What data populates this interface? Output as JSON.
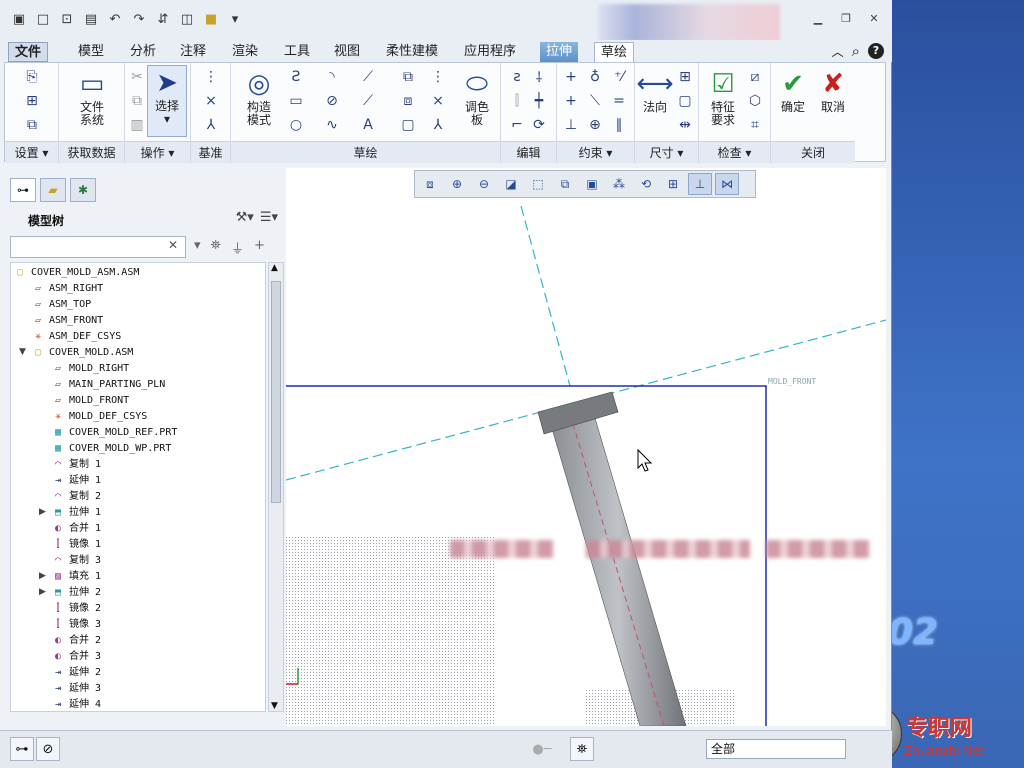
{
  "titlebar": {
    "qat_icons": [
      "app-icon",
      "new-icon",
      "open-icon",
      "save-icon",
      "undo-icon",
      "redo-icon",
      "regenerate-icon",
      "windows-icon",
      "folder-icon",
      "more-icon"
    ],
    "window_controls": [
      "minimize",
      "restore",
      "close"
    ]
  },
  "tabs": [
    "文件",
    "模型",
    "分析",
    "注释",
    "渲染",
    "工具",
    "视图",
    "柔性建模",
    "应用程序",
    "拉伸",
    "草绘"
  ],
  "ribbon": {
    "groups": [
      {
        "label": "设置",
        "dropdown": true
      },
      {
        "label": "获取数据"
      },
      {
        "label": "操作",
        "dropdown": true
      },
      {
        "label": "基准"
      },
      {
        "label": "草绘"
      },
      {
        "label": "编辑"
      },
      {
        "label": "约束",
        "dropdown": true
      },
      {
        "label": "尺寸",
        "dropdown": true
      },
      {
        "label": "检查",
        "dropdown": true
      },
      {
        "label": "关闭"
      }
    ],
    "file_system": "文件\n系统",
    "select": "选择",
    "construction_mode": "构造\n模式",
    "palette": "调色\n板",
    "normal": "法向",
    "feature_req": "特征\n要求",
    "ok": "确定",
    "cancel": "取消"
  },
  "model_tree": {
    "title": "模型树",
    "search_placeholder": "",
    "items": [
      {
        "label": "COVER_MOLD_ASM.ASM",
        "level": 0,
        "icon": "asm"
      },
      {
        "label": "ASM_RIGHT",
        "level": 1,
        "icon": "plane"
      },
      {
        "label": "ASM_TOP",
        "level": 1,
        "icon": "plane"
      },
      {
        "label": "ASM_FRONT",
        "level": 1,
        "icon": "plane"
      },
      {
        "label": "ASM_DEF_CSYS",
        "level": 1,
        "icon": "csys"
      },
      {
        "label": "COVER_MOLD.ASM",
        "level": 1,
        "icon": "asm",
        "expanded": true
      },
      {
        "label": "MOLD_RIGHT",
        "level": 2,
        "icon": "plane"
      },
      {
        "label": "MAIN_PARTING_PLN",
        "level": 2,
        "icon": "plane"
      },
      {
        "label": "MOLD_FRONT",
        "level": 2,
        "icon": "plane"
      },
      {
        "label": "MOLD_DEF_CSYS",
        "level": 2,
        "icon": "csys"
      },
      {
        "label": "COVER_MOLD_REF.PRT",
        "level": 2,
        "icon": "part"
      },
      {
        "label": "COVER_MOLD_WP.PRT",
        "level": 2,
        "icon": "part"
      },
      {
        "label": "复制 1",
        "level": 2,
        "icon": "surf"
      },
      {
        "label": "延伸 1",
        "level": 2,
        "icon": "extend"
      },
      {
        "label": "复制 2",
        "level": 2,
        "icon": "surf"
      },
      {
        "label": "拉伸 1",
        "level": 2,
        "icon": "extrude",
        "collapsed": true
      },
      {
        "label": "合并 1",
        "level": 2,
        "icon": "merge"
      },
      {
        "label": "镜像 1",
        "level": 2,
        "icon": "mirror"
      },
      {
        "label": "复制 3",
        "level": 2,
        "icon": "surf"
      },
      {
        "label": "填充 1",
        "level": 2,
        "icon": "fill",
        "collapsed": true
      },
      {
        "label": "拉伸 2",
        "level": 2,
        "icon": "extrude",
        "collapsed": true
      },
      {
        "label": "镜像 2",
        "level": 2,
        "icon": "mirror"
      },
      {
        "label": "镜像 3",
        "level": 2,
        "icon": "mirror"
      },
      {
        "label": "合并 2",
        "level": 2,
        "icon": "merge"
      },
      {
        "label": "合并 3",
        "level": 2,
        "icon": "merge"
      },
      {
        "label": "延伸 2",
        "level": 2,
        "icon": "extend"
      },
      {
        "label": "延伸 3",
        "level": 2,
        "icon": "extend"
      },
      {
        "label": "延伸 4",
        "level": 2,
        "icon": "extend"
      }
    ]
  },
  "viewport": {
    "plane_label": "MOLD_FRONT"
  },
  "statusbar": {
    "filter": "全部"
  },
  "watermark": {
    "number": "02",
    "site": "专职网",
    "url": "Zhuanzhi.Net"
  }
}
